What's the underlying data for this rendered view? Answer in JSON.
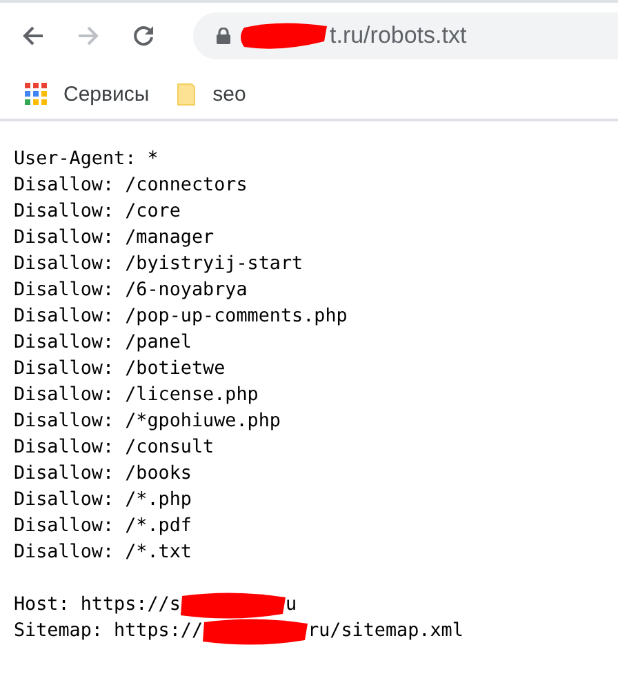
{
  "toolbar": {
    "nav": [
      {
        "kind": "back",
        "disabled": false
      },
      {
        "kind": "forward",
        "disabled": true
      },
      {
        "kind": "reload",
        "disabled": false
      }
    ],
    "address": {
      "redacted": true,
      "text": "t.ru/robots.txt"
    }
  },
  "bookmarks": [
    {
      "kind": "apps",
      "label": "Сервисы"
    },
    {
      "kind": "folder",
      "label": "seo"
    }
  ],
  "lines": [
    {
      "kind": "plain",
      "text": "User-Agent: *"
    },
    {
      "kind": "plain",
      "text": "Disallow: /connectors"
    },
    {
      "kind": "plain",
      "text": "Disallow: /core"
    },
    {
      "kind": "plain",
      "text": "Disallow: /manager"
    },
    {
      "kind": "plain",
      "text": "Disallow: /byistryij-start"
    },
    {
      "kind": "plain",
      "text": "Disallow: /6-noyabrya"
    },
    {
      "kind": "plain",
      "text": "Disallow: /pop-up-comments.php"
    },
    {
      "kind": "plain",
      "text": "Disallow: /panel"
    },
    {
      "kind": "plain",
      "text": "Disallow: /botietwe"
    },
    {
      "kind": "plain",
      "text": "Disallow: /license.php"
    },
    {
      "kind": "plain",
      "text": "Disallow: /*gpohiuwe.php"
    },
    {
      "kind": "plain",
      "text": "Disallow: /consult"
    },
    {
      "kind": "plain",
      "text": "Disallow: /books"
    },
    {
      "kind": "plain",
      "text": "Disallow: /*.php"
    },
    {
      "kind": "plain",
      "text": "Disallow: /*.pdf"
    },
    {
      "kind": "plain",
      "text": "Disallow: /*.txt"
    },
    {
      "kind": "blank"
    },
    {
      "kind": "redacted",
      "before": "Host: https://s",
      "after": "u"
    },
    {
      "kind": "redacted",
      "before": "Sitemap: https://",
      "after": "ru/sitemap.xml"
    }
  ]
}
